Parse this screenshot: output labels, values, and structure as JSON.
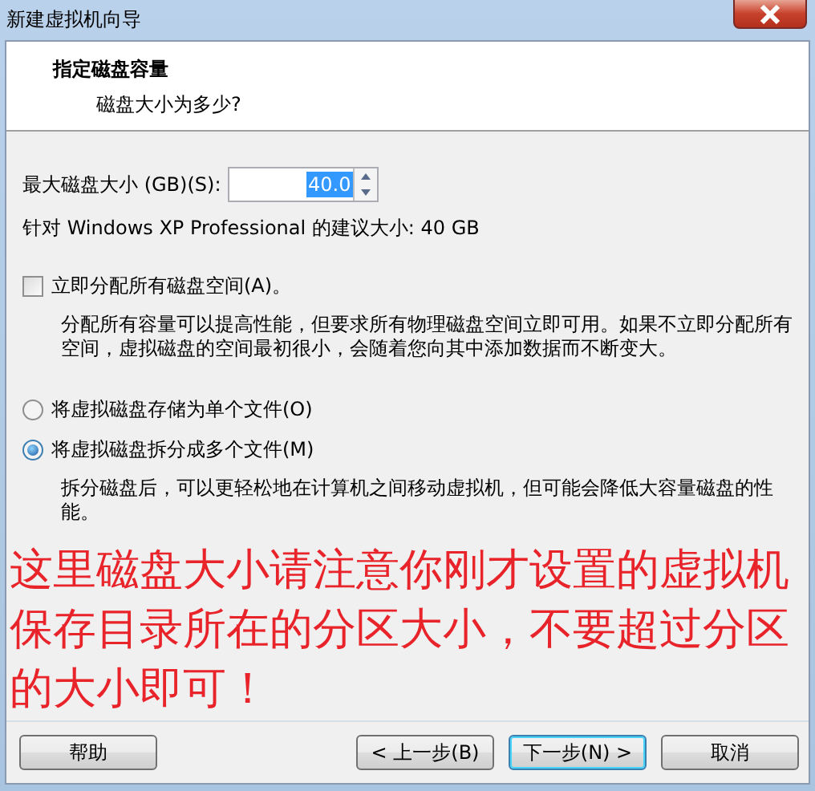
{
  "window": {
    "title": "新建虚拟机向导"
  },
  "header": {
    "title": "指定磁盘容量",
    "subtitle": "磁盘大小为多少?"
  },
  "disk_size": {
    "label": "最大磁盘大小 (GB)(S):",
    "value": "40.0",
    "text_selected": true
  },
  "recommendation": "针对 Windows XP Professional 的建议大小: 40 GB",
  "allocate": {
    "label": "立即分配所有磁盘空间(A)。",
    "checked": false,
    "description": "分配所有容量可以提高性能，但要求所有物理磁盘空间立即可用。如果不立即分配所有空间，虚拟磁盘的空间最初很小，会随着您向其中添加数据而不断变大。"
  },
  "storage_options": [
    {
      "label": "将虚拟磁盘存储为单个文件(O)",
      "selected": false
    },
    {
      "label": "将虚拟磁盘拆分成多个文件(M)",
      "selected": true,
      "description": "拆分磁盘后，可以更轻松地在计算机之间移动虚拟机，但可能会降低大容量磁盘的性能。"
    }
  ],
  "annotation": "这里磁盘大小请注意你刚才设置的虚拟机保存目录所在的分区大小，不要超过分区的大小即可！",
  "buttons": [
    {
      "label": "帮助",
      "kind": "help"
    },
    {
      "label": "< 上一步(B)",
      "kind": "normal"
    },
    {
      "label": "下一步(N) >",
      "kind": "default"
    },
    {
      "label": "取消",
      "kind": "normal"
    }
  ]
}
